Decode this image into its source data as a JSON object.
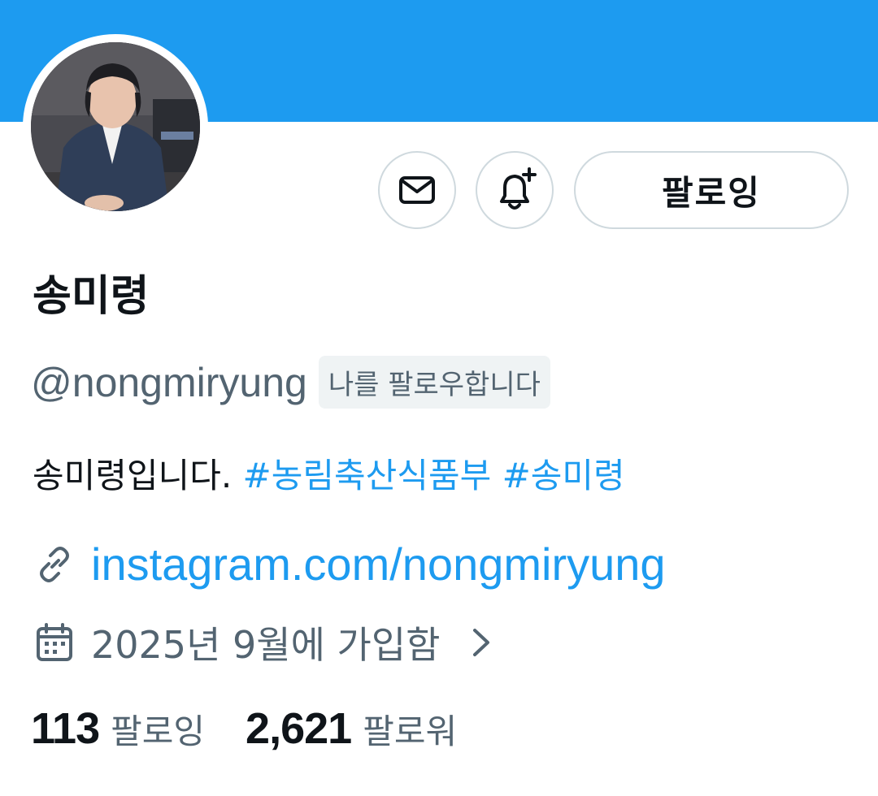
{
  "colors": {
    "banner": "#1d9bf0",
    "link": "#1d9bf0",
    "secondary_text": "#536471",
    "primary_text": "#0f1419",
    "button_border": "#cfd9de"
  },
  "profile": {
    "name": "송미령",
    "handle": "@nongmiryung",
    "follows_you": "나를 팔로우합니다",
    "bio": {
      "text": "송미령입니다. ",
      "hashtags": [
        "#농림축산식품부",
        "#송미령"
      ]
    },
    "website": "instagram.com/nongmiryung",
    "joined": "2025년 9월에 가입함"
  },
  "actions": {
    "message_icon": "mail-icon",
    "notify_icon": "bell-plus-icon",
    "follow_label": "팔로잉"
  },
  "stats": {
    "following_count": "113",
    "following_label": "팔로잉",
    "followers_count": "2,621",
    "followers_label": "팔로워"
  },
  "icons": {
    "link": "link-icon",
    "calendar": "calendar-icon",
    "chevron": "chevron-right-icon"
  }
}
